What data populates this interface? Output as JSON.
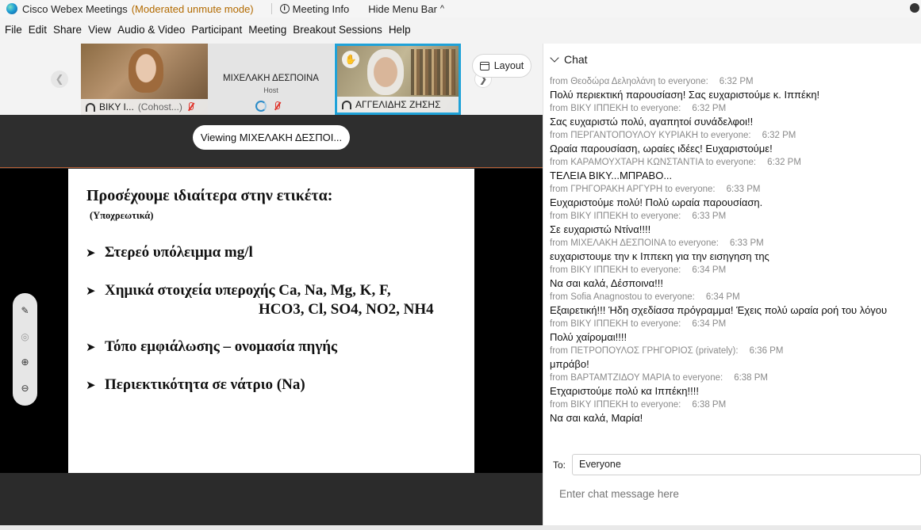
{
  "titlebar": {
    "app_title": "Cisco Webex Meetings",
    "mode": "(Moderated unmute mode)",
    "meeting_info": "Meeting Info",
    "hide_menu": "Hide Menu Bar",
    "hide_menu_icon": "chevron-up-icon"
  },
  "menu": [
    "File",
    "Edit",
    "Share",
    "View",
    "Audio & Video",
    "Participant",
    "Meeting",
    "Breakout Sessions",
    "Help"
  ],
  "participants": [
    {
      "name": "ΒΙΚΥ Ι...",
      "role": "(Cohost...)",
      "muted": true
    },
    {
      "name": "ΜΙΧΕΛΑΚΗ ΔΕΣΠΟΙΝΑ",
      "role": "Host",
      "muted": true
    },
    {
      "name": "ΑΓΓΕΛΙΔΗΣ ΖΗΣΗΣ",
      "role": "",
      "muted": false,
      "active_speaker": true
    }
  ],
  "layout_label": "Layout",
  "stage": {
    "viewing": "Viewing ΜΙΧΕΛΑΚΗ ΔΕΣΠΟΙ..."
  },
  "slide": {
    "title": "Προσέχουμε ιδιαίτερα στην ετικέτα:",
    "subtitle": "(Υποχρεωτικά)",
    "bullets": [
      "Στερεό υπόλειμμα    mg/l",
      "Χημικά στοιχεία υπεροχής   Ca, Na, Mg, K,   F,",
      "Τόπο εμφιάλωσης – ονομασία πηγής",
      "Περιεκτικότητα σε νάτριο  (Na)"
    ],
    "bullet2_cont": "HCO3,  Cl,  SO4, NO2,  NH4"
  },
  "chat": {
    "header": "Chat",
    "messages": [
      {
        "from": "from Θεοδώρα Δεληολάνη to everyone:",
        "time": "6:32 PM",
        "text": "Πολύ περιεκτική παρουσίαση! Σας ευχαριστούμε κ. Ιππέκη!"
      },
      {
        "from": "from ΒΙΚΥ ΙΠΠΕΚΗ to everyone:",
        "time": "6:32 PM",
        "text": "Σας ευχαριστώ πολύ, αγαπητοί συνάδελφοι!!"
      },
      {
        "from": "from ΠΕΡΓΑΝΤΟΠΟΥΛΟΥ ΚΥΡΙΑΚΗ to everyone:",
        "time": "6:32 PM",
        "text": "Ωραία παρουσίαση, ωραίες ιδέες! Ευχαριστούμε!"
      },
      {
        "from": "from ΚΑΡΑΜΟΥΧΤΑΡΗ ΚΩΝΣΤΑΝΤΙΑ to everyone:",
        "time": "6:32 PM",
        "text": "ΤΕΛΕΙΑ ΒΙΚΥ...ΜΠΡΑΒΟ..."
      },
      {
        "from": "from ΓΡΗΓΟΡΑΚΗ ΑΡΓΥΡΗ to everyone:",
        "time": "6:33 PM",
        "text": "Ευχαριστούμε πολύ! Πολύ ωραία παρουσίαση."
      },
      {
        "from": "from ΒΙΚΥ ΙΠΠΕΚΗ to everyone:",
        "time": "6:33 PM",
        "text": "Σε ευχαριστώ Ντίνα!!!!"
      },
      {
        "from": "from ΜΙΧΕΛΑΚΗ ΔΕΣΠΟΙΝΑ to everyone:",
        "time": "6:33 PM",
        "text": "ευχαριστουμε την κ Ιππεκη για την εισηγηση της"
      },
      {
        "from": "from ΒΙΚΥ ΙΠΠΕΚΗ to everyone:",
        "time": "6:34 PM",
        "text": "Να σαι καλά, Δέσποινα!!!"
      },
      {
        "from": "from Sofia Anagnostou to everyone:",
        "time": "6:34 PM",
        "text": "Εξαιρετική!!! Ήδη σχεδίασα πρόγραμμα! Έχεις πολύ ωραία ροή του λόγου"
      },
      {
        "from": "from ΒΙΚΥ ΙΠΠΕΚΗ to everyone:",
        "time": "6:34 PM",
        "text": "Πολύ χαίρομαι!!!!"
      },
      {
        "from": "from ΠΕΤΡΟΠΟΥΛΟΣ ΓΡΗΓΟΡΙΟΣ (privately):",
        "time": "6:36 PM",
        "text": "μπράβο!"
      },
      {
        "from": "from ΒΑΡΤΑΜΤΖΙΔΟΥ ΜΑΡΙΑ to everyone:",
        "time": "6:38 PM",
        "text": "Ετχαριστούμε  πολύ κα Ιππέκη!!!!"
      },
      {
        "from": "from ΒΙΚΥ ΙΠΠΕΚΗ to everyone:",
        "time": "6:38 PM",
        "text": "Να σαι καλά, Μαρία!"
      }
    ],
    "to_label": "To:",
    "to_value": "Everyone",
    "input_placeholder": "Enter chat message here"
  }
}
